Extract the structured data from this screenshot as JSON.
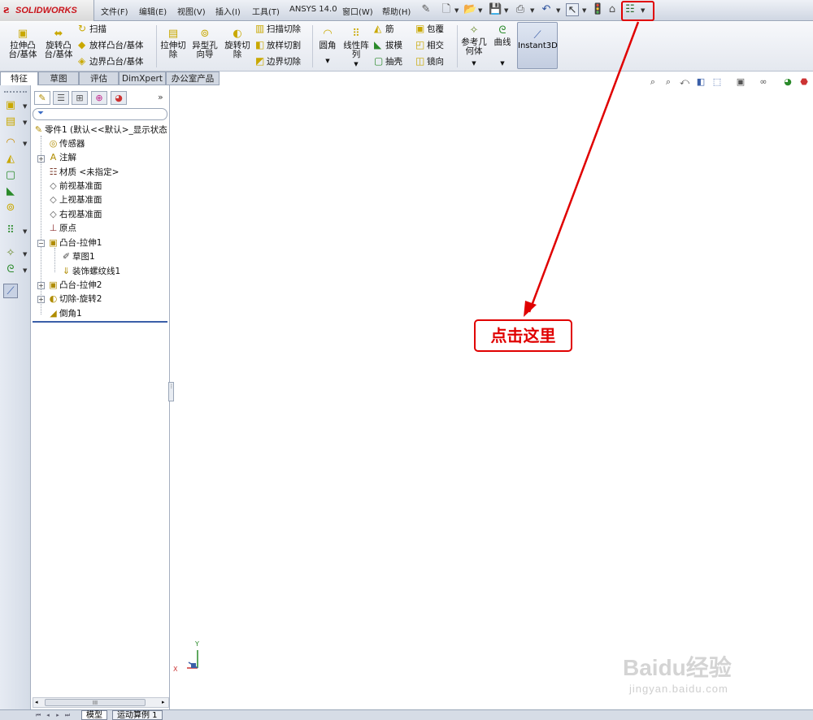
{
  "app": {
    "brand": "SOLIDWORKS"
  },
  "menu": [
    "文件(F)",
    "编辑(E)",
    "视图(V)",
    "插入(I)",
    "工具(T)",
    "ANSYS 14.0",
    "窗口(W)",
    "帮助(H)"
  ],
  "ribbon": {
    "extrude_boss": "拉伸凸台/基体",
    "revolve_boss": "旋转凸台/基体",
    "sweep": "扫描",
    "loft_boss": "放样凸台/基体",
    "boundary_boss": "边界凸台/基体",
    "extrude_cut": "拉伸切除",
    "hole_wizard": "异型孔向导",
    "revolve_cut": "旋转切除",
    "sweep_cut": "扫描切除",
    "loft_cut": "放样切割",
    "boundary_cut": "边界切除",
    "fillet": "圆角",
    "linear_pattern": "线性阵列",
    "rib": "筋",
    "draft": "拔模",
    "shell": "抽壳",
    "wrap": "包覆",
    "intersect": "相交",
    "mirror": "镜向",
    "reference_geometry": "参考几何体",
    "curves": "曲线",
    "instant3d": "Instant3D"
  },
  "command_tabs": [
    "特征",
    "草图",
    "评估",
    "DimXpert",
    "办公室产品"
  ],
  "tree": {
    "root": "零件1  (默认<<默认>_显示状态",
    "items": [
      "传感器",
      "注解",
      "材质 <未指定>",
      "前视基准面",
      "上视基准面",
      "右视基准面",
      "原点",
      "凸台-拉伸1",
      "草图1",
      "装饰螺纹线1",
      "凸台-拉伸2",
      "切除-旋转2",
      "倒角1"
    ],
    "scroll_thumb": "III"
  },
  "bottom_tabs": [
    "模型",
    "运动算例 1"
  ],
  "annotation": {
    "callout_text": "点击这里",
    "color": "#e00000"
  },
  "axes": {
    "x": "X",
    "y": "Y"
  },
  "watermark": {
    "main": "Baidu经验",
    "url": "jingyan.baidu.com"
  }
}
